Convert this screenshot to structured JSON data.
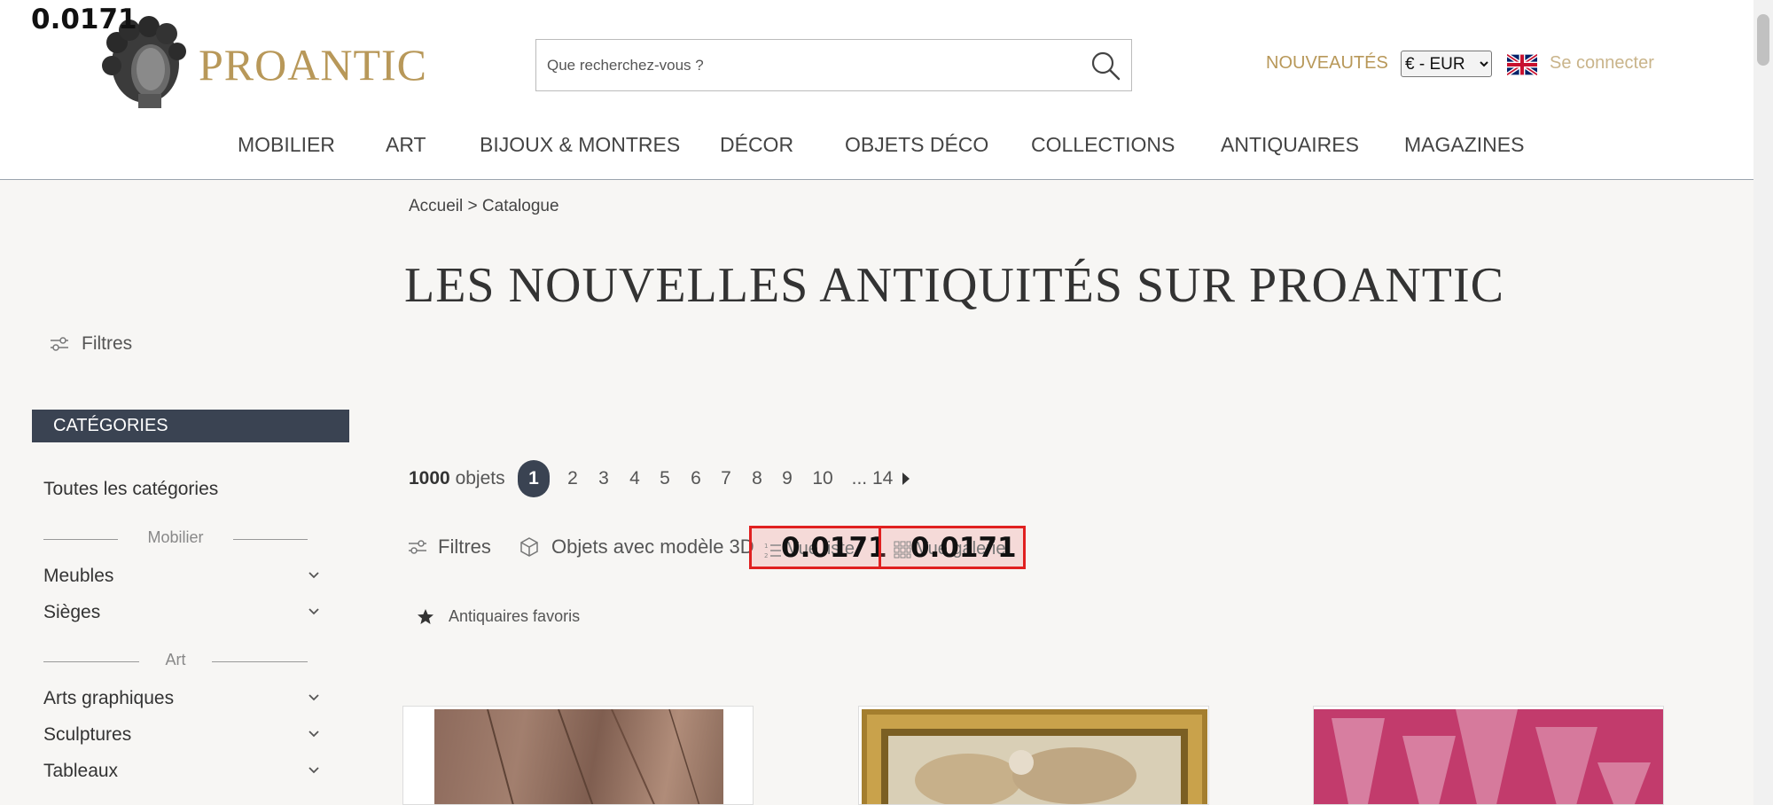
{
  "overlay": {
    "score_main": "0.0171",
    "score_list": "0.0171",
    "score_gallery": "0.0171"
  },
  "header": {
    "logo_text": "PROANTIC",
    "search_placeholder": "Que recherchez-vous ?",
    "nouveautes": "NOUVEAUTÉS",
    "currency": "€ - EUR",
    "login": "Se connecter"
  },
  "nav": [
    "MOBILIER",
    "ART",
    "BIJOUX & MONTRES",
    "DÉCOR",
    "OBJETS DÉCO",
    "COLLECTIONS",
    "ANTIQUAIRES",
    "MAGAZINES"
  ],
  "sidebar": {
    "filters_label": "Filtres",
    "categories_header": "CATÉGORIES",
    "all_categories": "Toutes les catégories",
    "group_mobilier": "Mobilier",
    "meubles": "Meubles",
    "sieges": "Sièges",
    "group_art": "Art",
    "arts_graphiques": "Arts graphiques",
    "sculptures": "Sculptures",
    "tableaux": "Tableaux"
  },
  "main": {
    "breadcrumb": "Accueil > Catalogue",
    "title": "LES NOUVELLES ANTIQUITÉS SUR PROANTIC",
    "count_number": "1000",
    "count_label": "objets",
    "pages": [
      "1",
      "2",
      "3",
      "4",
      "5",
      "6",
      "7",
      "8",
      "9",
      "10",
      "... 14"
    ],
    "filters_label": "Filtres",
    "objects_3d": "Objets avec modèle 3D",
    "view_list": "Vue liste",
    "view_gallery": "Vue galerie",
    "fav_dealers": "Antiquaires favoris"
  },
  "colors": {
    "gold": "#b89859",
    "dark_navy": "#3a4352",
    "highlight_red": "#e02020",
    "bg": "#f7f6f4"
  }
}
